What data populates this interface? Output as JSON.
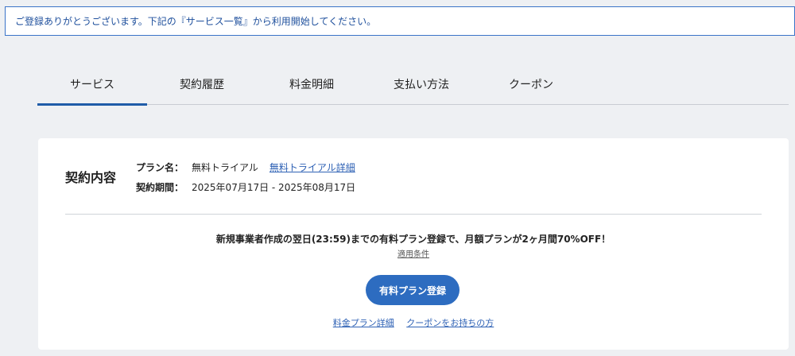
{
  "notice": {
    "text": "ご登録ありがとうございます。下記の『サービス一覧』から利用開始してください。"
  },
  "tabs": [
    {
      "label": "サービス",
      "active": true
    },
    {
      "label": "契約履歴",
      "active": false
    },
    {
      "label": "料金明細",
      "active": false
    },
    {
      "label": "支払い方法",
      "active": false
    },
    {
      "label": "クーポン",
      "active": false
    }
  ],
  "contract": {
    "title": "契約内容",
    "plan_label": "プラン名：",
    "plan_value": "無料トライアル",
    "plan_link": "無料トライアル詳細",
    "period_label": "契約期間：",
    "period_value": "2025年07月17日 - 2025年08月17日"
  },
  "promo": {
    "text": "新規事業者作成の翌日(23:59)までの有料プラン登録で、月額プランが2ヶ月間70%OFF！",
    "terms_link": "適用条件",
    "cta_label": "有料プラン登録",
    "pricing_link": "料金プラン詳細",
    "coupon_link": "クーポンをお持ちの方"
  },
  "colors": {
    "accent": "#1f5ca8",
    "button": "#2d6cc0",
    "link": "#2f62b5",
    "background": "#eef0f3"
  }
}
